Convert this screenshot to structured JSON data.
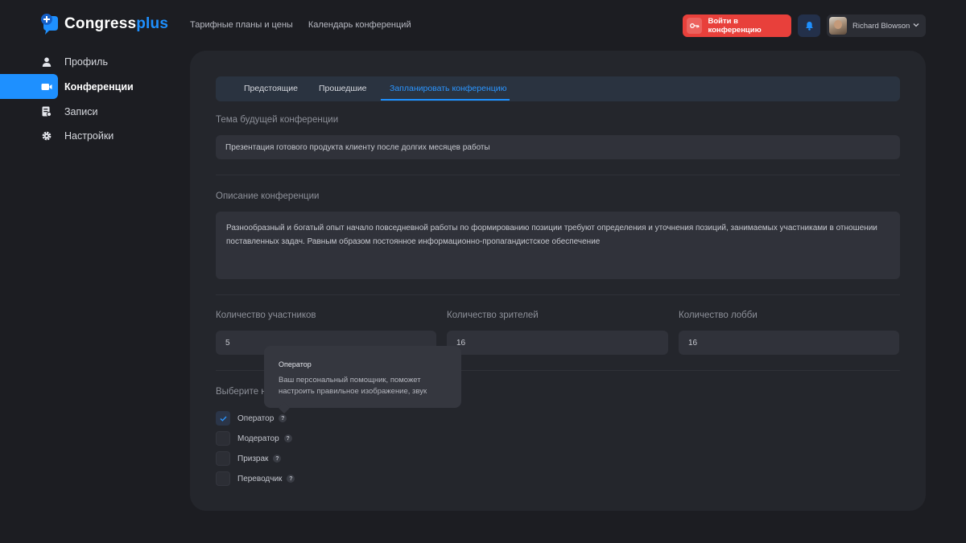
{
  "app": {
    "logo_part1": "Congress",
    "logo_part2": "plus"
  },
  "header": {
    "links": [
      "Тарифные планы и цены",
      "Календарь конференций"
    ],
    "join_button": "Войти в конференцию",
    "user_name": "Richard Blowson"
  },
  "colors": {
    "accent": "#1e90ff",
    "danger": "#e8403b",
    "background": "#1c1d22",
    "panel": "#24262c"
  },
  "sidebar": {
    "items": [
      {
        "label": "Профиль",
        "icon": "user-icon"
      },
      {
        "label": "Конференции",
        "icon": "video-camera-icon",
        "active": true
      },
      {
        "label": "Записи",
        "icon": "records-icon"
      },
      {
        "label": "Настройки",
        "icon": "gear-icon"
      }
    ]
  },
  "tabs": [
    {
      "label": "Предстоящие"
    },
    {
      "label": "Прошедшие"
    },
    {
      "label": "Запланировать конференцию",
      "active": true
    }
  ],
  "form": {
    "topic": {
      "label": "Тема будущей конференции",
      "value": "Презентация готового продукта клиенту после долгих месяцев работы"
    },
    "description": {
      "label": "Описание конференции",
      "value": "Разнообразный и богатый опыт начало повседневной работы по формированию позиции требуют определения и уточнения позиций, занимаемых участниками в отношении поставленных задач. Равным образом постоянное информационно-пропагандистское обеспечение"
    },
    "participants": {
      "label": "Количество участников",
      "value": "5"
    },
    "viewers": {
      "label": "Количество зрителей",
      "value": "16"
    },
    "lobby": {
      "label": "Количество лобби",
      "value": "16"
    },
    "roles": {
      "label_visible": "Выберите н",
      "options": [
        {
          "label": "Оператор",
          "checked": true
        },
        {
          "label": "Модератор",
          "checked": false
        },
        {
          "label": "Призрак",
          "checked": false
        },
        {
          "label": "Переводчик",
          "checked": false
        }
      ]
    }
  },
  "tooltip": {
    "title": "Оператор",
    "body": "Ваш персональный помощник, поможет настроить правильное изображение, звук"
  },
  "help_glyph": "?"
}
